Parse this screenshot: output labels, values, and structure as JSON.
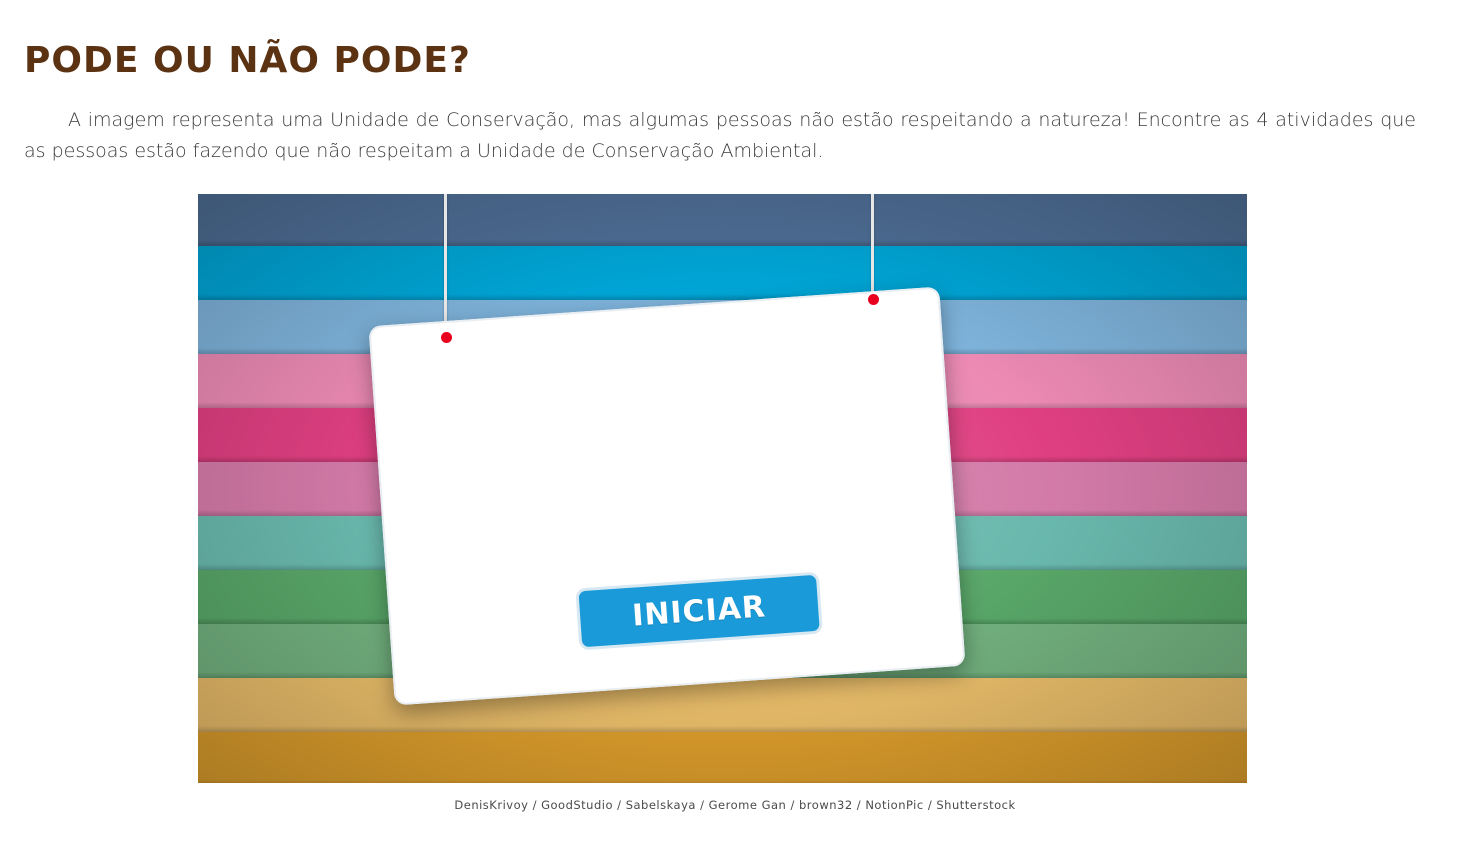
{
  "header": {
    "title": "PODE OU NÃO PODE?"
  },
  "intro": {
    "text": "A imagem representa uma Unidade de Conservação, mas algumas pessoas não estão respeitando a natureza! Encontre as 4 atividades que as pessoas estão fazendo que não respeitam a Unidade de Conservação Ambiental."
  },
  "activity": {
    "start_label": "INICIAR",
    "stripe_colors": [
      "#4f6f97",
      "#00a7d8",
      "#7fb4dc",
      "#ec8ab4",
      "#df3f81",
      "#d37aa8",
      "#69b8ad",
      "#58a668",
      "#72b07e",
      "#e9bd6a",
      "#dd9e2c"
    ],
    "pin_color": "#e8001e",
    "button_color": "#1a9ad8"
  },
  "credits": {
    "text": "DenisKrivoy / GoodStudio / Sabelskaya / Gerome Gan / brown32 / NotionPic / Shutterstock"
  }
}
